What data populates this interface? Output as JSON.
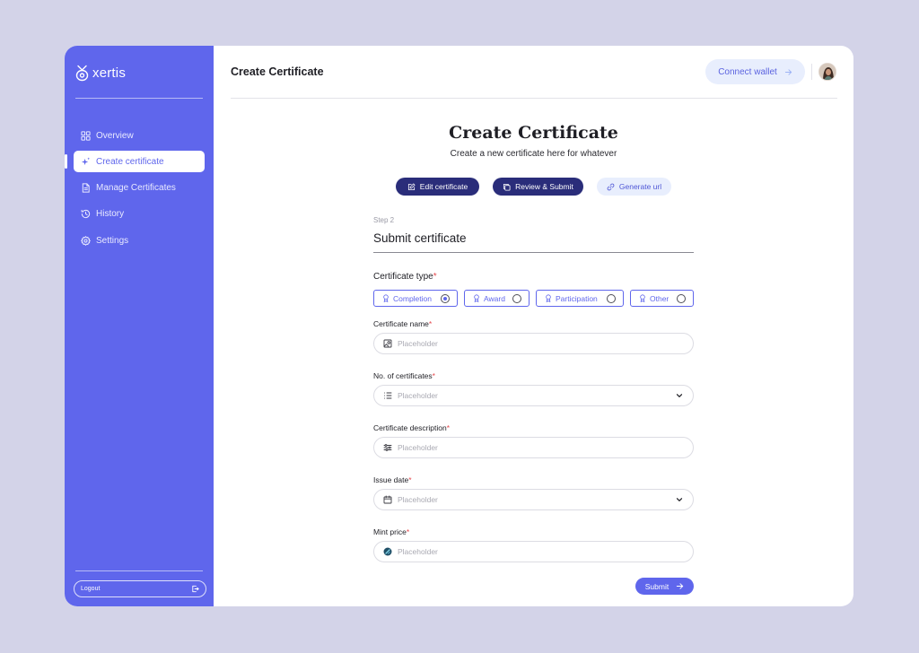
{
  "brand": {
    "name": "xertis",
    "logo_icon": "shield-logo-icon"
  },
  "sidebar": {
    "items": [
      {
        "label": "Overview",
        "icon": "grid-icon",
        "active": false
      },
      {
        "label": "Create certificate",
        "icon": "sparkle-icon",
        "active": true
      },
      {
        "label": "Manage Certificates",
        "icon": "document-icon",
        "active": false
      },
      {
        "label": "History",
        "icon": "history-icon",
        "active": false
      },
      {
        "label": "Settings",
        "icon": "gear-icon",
        "active": false
      }
    ],
    "logout_label": "Logout"
  },
  "header": {
    "title": "Create Certificate",
    "connect_wallet_label": "Connect wallet"
  },
  "page": {
    "heading": "Create Certificate",
    "subheading": "Create a new certificate here for whatever"
  },
  "steps": [
    {
      "label": "Edit certificate",
      "icon": "edit-icon",
      "style": "dark"
    },
    {
      "label": "Review & Submit",
      "icon": "copy-icon",
      "style": "dark"
    },
    {
      "label": "Generate url",
      "icon": "link-icon",
      "style": "light"
    }
  ],
  "form": {
    "step_label": "Step 2",
    "title": "Submit certificate",
    "certificate_type": {
      "label": "Certificate type",
      "required_mark": "*",
      "options": [
        {
          "label": "Completion",
          "selected": true
        },
        {
          "label": "Award",
          "selected": false
        },
        {
          "label": "Participation",
          "selected": false
        },
        {
          "label": "Other",
          "selected": false
        }
      ]
    },
    "fields": [
      {
        "label": "Certificate name",
        "required_mark": "*",
        "placeholder": "Placeholder",
        "icon": "image-icon",
        "dropdown": false
      },
      {
        "label": "No. of certificates",
        "required_mark": "*",
        "placeholder": "Placeholder",
        "icon": "list-icon",
        "dropdown": true
      },
      {
        "label": "Certificate description",
        "required_mark": "*",
        "placeholder": "Placeholder",
        "icon": "sliders-icon",
        "dropdown": false
      },
      {
        "label": "Issue date",
        "required_mark": "*",
        "placeholder": "Placeholder",
        "icon": "calendar-icon",
        "dropdown": true
      },
      {
        "label": "Mint price",
        "required_mark": "*",
        "placeholder": "Placeholder",
        "icon": "token-icon",
        "dropdown": false
      }
    ],
    "submit_label": "Submit"
  },
  "colors": {
    "accent": "#5f66ec",
    "accent_dark": "#2a2d7a",
    "pill_light": "#e8eefd",
    "background": "#d3d3e8",
    "required": "#e5484d"
  }
}
